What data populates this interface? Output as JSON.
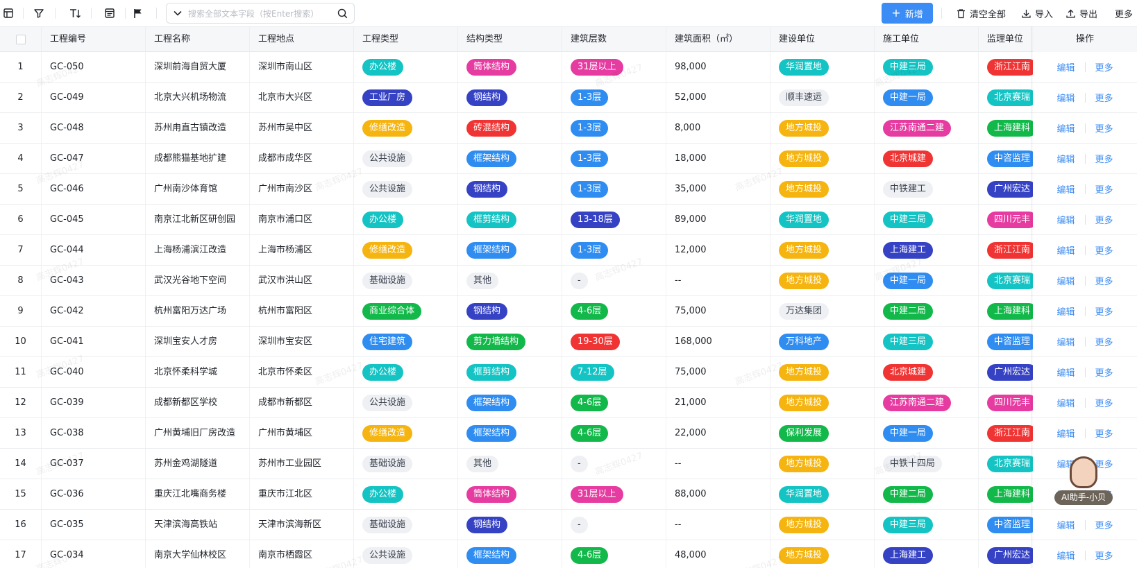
{
  "toolbar": {
    "search_placeholder": "搜索全部文本字段（按Enter搜索）",
    "new_label": "新增",
    "clear_label": "清空全部",
    "import_label": "导入",
    "export_label": "导出",
    "more_label": "更多"
  },
  "columns": [
    "工程编号",
    "工程名称",
    "工程地点",
    "工程类型",
    "结构类型",
    "建筑层数",
    "建筑面积（㎡）",
    "建设单位",
    "施工单位",
    "监理单位",
    "操作"
  ],
  "actions": {
    "edit": "编辑",
    "more": "更多"
  },
  "watermark": "高志辉0427",
  "ai_assistant_label": "AI助手-小贝",
  "tag_colors": {
    "blue": "#2f8cf0",
    "cyan": "#14c3c3",
    "pink": "#e63ba0",
    "red": "#f03434",
    "orange": "#f5b40f",
    "green": "#12b94a",
    "navy": "#3542c4",
    "plain": "#eef0f4"
  },
  "rows": [
    {
      "idx": "1",
      "code": "GC-050",
      "name": "深圳前海自贸大厦",
      "loc": "深圳市南山区",
      "ptype": {
        "t": "办公楼",
        "c": "cyan"
      },
      "stype": {
        "t": "筒体结构",
        "c": "pink"
      },
      "floors": {
        "t": "31层以上",
        "c": "pink"
      },
      "area": "98,000",
      "builder": {
        "t": "华润置地",
        "c": "cyan"
      },
      "contractor": {
        "t": "中建三局",
        "c": "cyan"
      },
      "supervisor": {
        "t": "浙江江南",
        "c": "red"
      }
    },
    {
      "idx": "2",
      "code": "GC-049",
      "name": "北京大兴机场物流",
      "loc": "北京市大兴区",
      "ptype": {
        "t": "工业厂房",
        "c": "navy"
      },
      "stype": {
        "t": "钢结构",
        "c": "navy"
      },
      "floors": {
        "t": "1-3层",
        "c": "blue"
      },
      "area": "52,000",
      "builder": {
        "t": "顺丰速运",
        "c": "plain"
      },
      "contractor": {
        "t": "中建一局",
        "c": "blue"
      },
      "supervisor": {
        "t": "北京赛瑞",
        "c": "cyan"
      }
    },
    {
      "idx": "3",
      "code": "GC-048",
      "name": "苏州甪直古镇改造",
      "loc": "苏州市吴中区",
      "ptype": {
        "t": "修缮改造",
        "c": "orange"
      },
      "stype": {
        "t": "砖混结构",
        "c": "red"
      },
      "floors": {
        "t": "1-3层",
        "c": "blue"
      },
      "area": "8,000",
      "builder": {
        "t": "地方城投",
        "c": "orange"
      },
      "contractor": {
        "t": "江苏南通二建",
        "c": "pink"
      },
      "supervisor": {
        "t": "上海建科",
        "c": "green"
      }
    },
    {
      "idx": "4",
      "code": "GC-047",
      "name": "成都熊猫基地扩建",
      "loc": "成都市成华区",
      "ptype": {
        "t": "公共设施",
        "c": "plain"
      },
      "stype": {
        "t": "框架结构",
        "c": "blue"
      },
      "floors": {
        "t": "1-3层",
        "c": "blue"
      },
      "area": "18,000",
      "builder": {
        "t": "地方城投",
        "c": "orange"
      },
      "contractor": {
        "t": "北京城建",
        "c": "red"
      },
      "supervisor": {
        "t": "中咨监理",
        "c": "blue"
      }
    },
    {
      "idx": "5",
      "code": "GC-046",
      "name": "广州南沙体育馆",
      "loc": "广州市南沙区",
      "ptype": {
        "t": "公共设施",
        "c": "plain"
      },
      "stype": {
        "t": "钢结构",
        "c": "navy"
      },
      "floors": {
        "t": "1-3层",
        "c": "blue"
      },
      "area": "35,000",
      "builder": {
        "t": "地方城投",
        "c": "orange"
      },
      "contractor": {
        "t": "中铁建工",
        "c": "plain"
      },
      "supervisor": {
        "t": "广州宏达",
        "c": "navy"
      }
    },
    {
      "idx": "6",
      "code": "GC-045",
      "name": "南京江北新区研创园",
      "loc": "南京市浦口区",
      "ptype": {
        "t": "办公楼",
        "c": "cyan"
      },
      "stype": {
        "t": "框剪结构",
        "c": "cyan"
      },
      "floors": {
        "t": "13-18层",
        "c": "navy"
      },
      "area": "89,000",
      "builder": {
        "t": "华润置地",
        "c": "cyan"
      },
      "contractor": {
        "t": "中建三局",
        "c": "cyan"
      },
      "supervisor": {
        "t": "四川元丰",
        "c": "pink"
      }
    },
    {
      "idx": "7",
      "code": "GC-044",
      "name": "上海杨浦滨江改造",
      "loc": "上海市杨浦区",
      "ptype": {
        "t": "修缮改造",
        "c": "orange"
      },
      "stype": {
        "t": "框架结构",
        "c": "blue"
      },
      "floors": {
        "t": "1-3层",
        "c": "blue"
      },
      "area": "12,000",
      "builder": {
        "t": "地方城投",
        "c": "orange"
      },
      "contractor": {
        "t": "上海建工",
        "c": "navy"
      },
      "supervisor": {
        "t": "浙江江南",
        "c": "red"
      }
    },
    {
      "idx": "8",
      "code": "GC-043",
      "name": "武汉光谷地下空间",
      "loc": "武汉市洪山区",
      "ptype": {
        "t": "基础设施",
        "c": "plain"
      },
      "stype": {
        "t": "其他",
        "c": "plain"
      },
      "floors": {
        "t": "-",
        "c": "plain"
      },
      "area": "--",
      "builder": {
        "t": "地方城投",
        "c": "orange"
      },
      "contractor": {
        "t": "中建一局",
        "c": "blue"
      },
      "supervisor": {
        "t": "北京赛瑞",
        "c": "cyan"
      }
    },
    {
      "idx": "9",
      "code": "GC-042",
      "name": "杭州富阳万达广场",
      "loc": "杭州市富阳区",
      "ptype": {
        "t": "商业综合体",
        "c": "green"
      },
      "stype": {
        "t": "钢结构",
        "c": "navy"
      },
      "floors": {
        "t": "4-6层",
        "c": "green"
      },
      "area": "75,000",
      "builder": {
        "t": "万达集团",
        "c": "plain"
      },
      "contractor": {
        "t": "中建二局",
        "c": "green"
      },
      "supervisor": {
        "t": "上海建科",
        "c": "green"
      }
    },
    {
      "idx": "10",
      "code": "GC-041",
      "name": "深圳宝安人才房",
      "loc": "深圳市宝安区",
      "ptype": {
        "t": "住宅建筑",
        "c": "blue"
      },
      "stype": {
        "t": "剪力墙结构",
        "c": "green"
      },
      "floors": {
        "t": "19-30层",
        "c": "red"
      },
      "area": "168,000",
      "builder": {
        "t": "万科地产",
        "c": "blue"
      },
      "contractor": {
        "t": "中建三局",
        "c": "cyan"
      },
      "supervisor": {
        "t": "中咨监理",
        "c": "blue"
      }
    },
    {
      "idx": "11",
      "code": "GC-040",
      "name": "北京怀柔科学城",
      "loc": "北京市怀柔区",
      "ptype": {
        "t": "办公楼",
        "c": "cyan"
      },
      "stype": {
        "t": "框剪结构",
        "c": "cyan"
      },
      "floors": {
        "t": "7-12层",
        "c": "cyan"
      },
      "area": "75,000",
      "builder": {
        "t": "地方城投",
        "c": "orange"
      },
      "contractor": {
        "t": "北京城建",
        "c": "red"
      },
      "supervisor": {
        "t": "广州宏达",
        "c": "navy"
      }
    },
    {
      "idx": "12",
      "code": "GC-039",
      "name": "成都新都区学校",
      "loc": "成都市新都区",
      "ptype": {
        "t": "公共设施",
        "c": "plain"
      },
      "stype": {
        "t": "框架结构",
        "c": "blue"
      },
      "floors": {
        "t": "4-6层",
        "c": "green"
      },
      "area": "21,000",
      "builder": {
        "t": "地方城投",
        "c": "orange"
      },
      "contractor": {
        "t": "江苏南通二建",
        "c": "pink"
      },
      "supervisor": {
        "t": "四川元丰",
        "c": "pink"
      }
    },
    {
      "idx": "13",
      "code": "GC-038",
      "name": "广州黄埔旧厂房改造",
      "loc": "广州市黄埔区",
      "ptype": {
        "t": "修缮改造",
        "c": "orange"
      },
      "stype": {
        "t": "框架结构",
        "c": "blue"
      },
      "floors": {
        "t": "4-6层",
        "c": "green"
      },
      "area": "22,000",
      "builder": {
        "t": "保利发展",
        "c": "green"
      },
      "contractor": {
        "t": "中建一局",
        "c": "blue"
      },
      "supervisor": {
        "t": "浙江江南",
        "c": "red"
      }
    },
    {
      "idx": "14",
      "code": "GC-037",
      "name": "苏州金鸡湖隧道",
      "loc": "苏州市工业园区",
      "ptype": {
        "t": "基础设施",
        "c": "plain"
      },
      "stype": {
        "t": "其他",
        "c": "plain"
      },
      "floors": {
        "t": "-",
        "c": "plain"
      },
      "area": "--",
      "builder": {
        "t": "地方城投",
        "c": "orange"
      },
      "contractor": {
        "t": "中铁十四局",
        "c": "plain"
      },
      "supervisor": {
        "t": "北京赛瑞",
        "c": "cyan"
      }
    },
    {
      "idx": "15",
      "code": "GC-036",
      "name": "重庆江北嘴商务楼",
      "loc": "重庆市江北区",
      "ptype": {
        "t": "办公楼",
        "c": "cyan"
      },
      "stype": {
        "t": "筒体结构",
        "c": "pink"
      },
      "floors": {
        "t": "31层以上",
        "c": "pink"
      },
      "area": "88,000",
      "builder": {
        "t": "华润置地",
        "c": "cyan"
      },
      "contractor": {
        "t": "中建二局",
        "c": "green"
      },
      "supervisor": {
        "t": "上海建科",
        "c": "green"
      }
    },
    {
      "idx": "16",
      "code": "GC-035",
      "name": "天津滨海高铁站",
      "loc": "天津市滨海新区",
      "ptype": {
        "t": "基础设施",
        "c": "plain"
      },
      "stype": {
        "t": "钢结构",
        "c": "navy"
      },
      "floors": {
        "t": "-",
        "c": "plain"
      },
      "area": "--",
      "builder": {
        "t": "地方城投",
        "c": "orange"
      },
      "contractor": {
        "t": "中建三局",
        "c": "cyan"
      },
      "supervisor": {
        "t": "中咨监理",
        "c": "blue"
      }
    },
    {
      "idx": "17",
      "code": "GC-034",
      "name": "南京大学仙林校区",
      "loc": "南京市栖霞区",
      "ptype": {
        "t": "公共设施",
        "c": "plain"
      },
      "stype": {
        "t": "框架结构",
        "c": "blue"
      },
      "floors": {
        "t": "4-6层",
        "c": "green"
      },
      "area": "48,000",
      "builder": {
        "t": "地方城投",
        "c": "orange"
      },
      "contractor": {
        "t": "上海建工",
        "c": "navy"
      },
      "supervisor": {
        "t": "广州宏达",
        "c": "navy"
      }
    }
  ]
}
